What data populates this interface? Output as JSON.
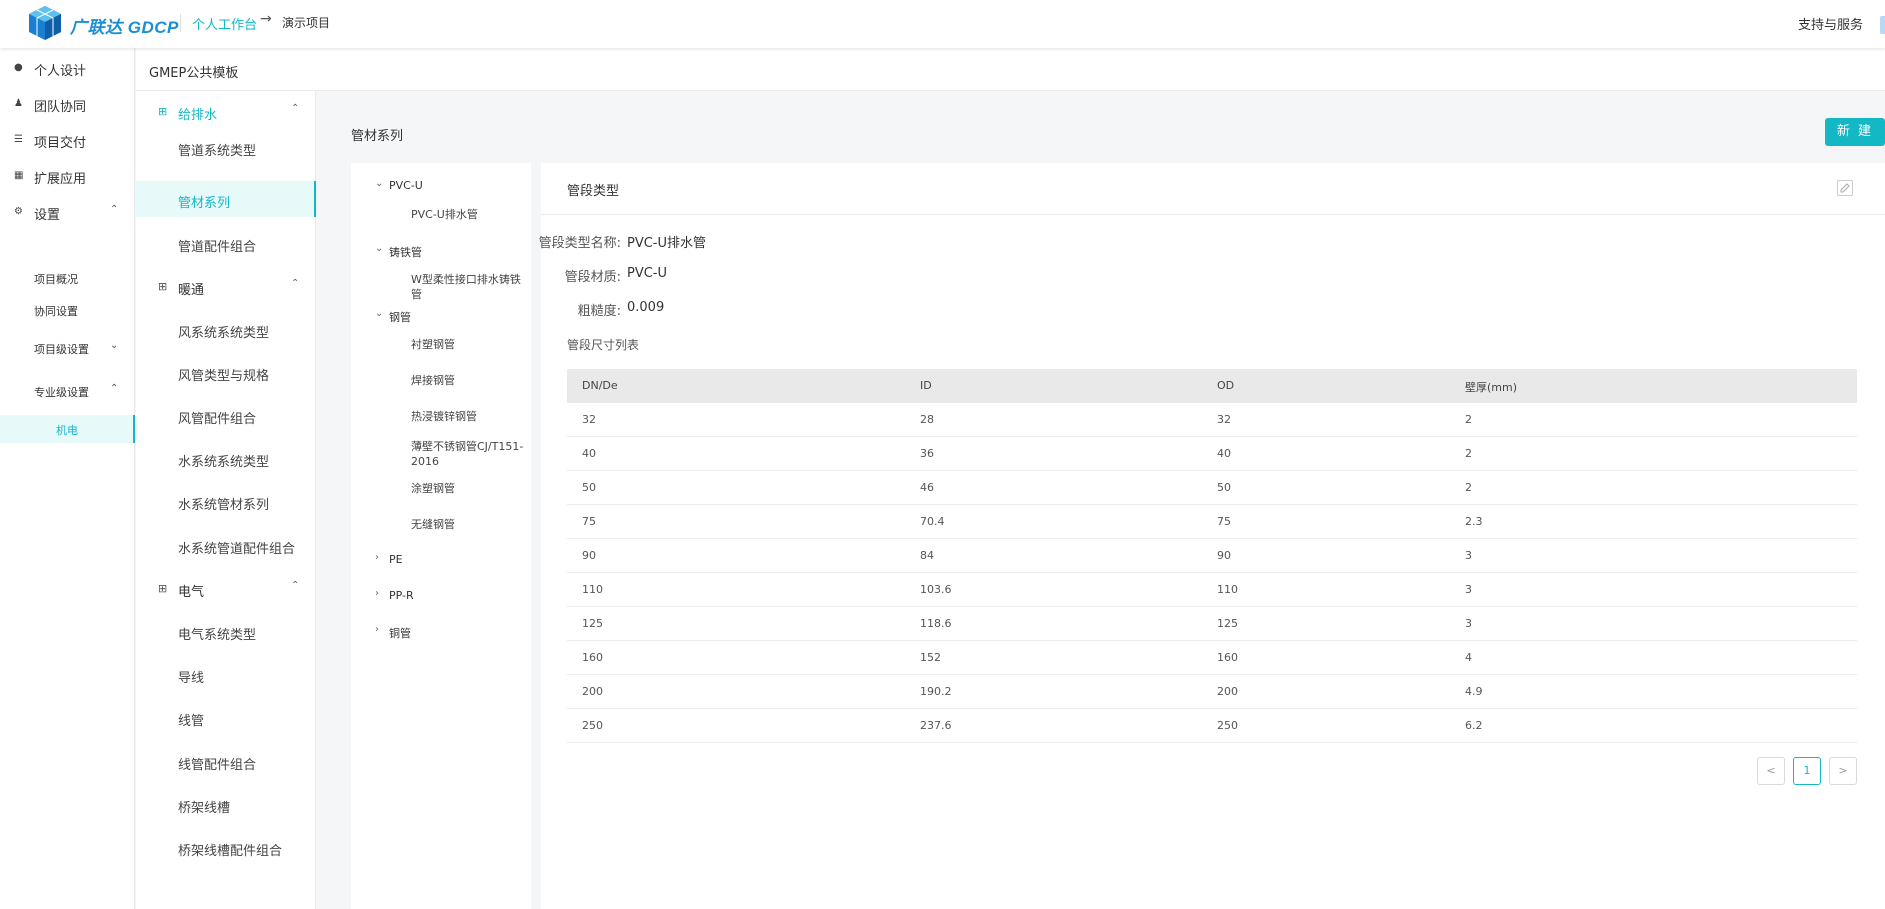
{
  "header": {
    "logo_text": "广联达 GDCP",
    "breadcrumb": [
      "个人工作台",
      "演示项目"
    ],
    "support": "支持与服务"
  },
  "sidebar": {
    "items": [
      {
        "label": "个人设计",
        "icon": "user-icon"
      },
      {
        "label": "团队协同",
        "icon": "team-icon"
      },
      {
        "label": "项目交付",
        "icon": "layers-icon"
      },
      {
        "label": "扩展应用",
        "icon": "apps-icon"
      },
      {
        "label": "设置",
        "icon": "gear-icon"
      }
    ],
    "settings_sub": {
      "overview": "项目概况",
      "collab": "协同设置",
      "project_level": "项目级设置",
      "specialty_level": "专业级设置",
      "mep": "机电"
    }
  },
  "template": {
    "title": "GMEP公共模板",
    "groups": [
      {
        "label": "给排水",
        "items": [
          "管道系统类型",
          "管材系列",
          "管道配件组合"
        ]
      },
      {
        "label": "暖通",
        "items": [
          "风系统系统类型",
          "风管类型与规格",
          "风管配件组合",
          "水系统系统类型",
          "水系统管材系列",
          "水系统管道配件组合"
        ]
      },
      {
        "label": "电气",
        "items": [
          "电气系统类型",
          "导线",
          "线管",
          "线管配件组合",
          "桥架线槽",
          "桥架线槽配件组合"
        ]
      }
    ]
  },
  "main": {
    "section_title": "管材系列",
    "new_button": "新 建",
    "tree": {
      "pvcu": "PVC-U",
      "pvcu_leaf": "PVC-U排水管",
      "cast_iron": "铸铁管",
      "cast_iron_leaf": "W型柔性接口排水铸铁管",
      "steel": "钢管",
      "steel_leaves": [
        "衬塑钢管",
        "焊接钢管",
        "热浸镀锌钢管",
        "薄壁不锈钢管CJ/T151-2016",
        "涂塑钢管",
        "无缝钢管"
      ],
      "pe": "PE",
      "ppr": "PP-R",
      "copper": "铜管"
    },
    "detail": {
      "title": "管段类型",
      "name_label": "管段类型名称:",
      "name_value": "PVC-U排水管",
      "material_label": "管段材质:",
      "material_value": "PVC-U",
      "roughness_label": "粗糙度:",
      "roughness_value": "0.009",
      "list_title": "管段尺寸列表",
      "columns": [
        "DN/De",
        "ID",
        "OD",
        "壁厚(mm)"
      ],
      "rows": [
        [
          "32",
          "28",
          "32",
          "2"
        ],
        [
          "40",
          "36",
          "40",
          "2"
        ],
        [
          "50",
          "46",
          "50",
          "2"
        ],
        [
          "75",
          "70.4",
          "75",
          "2.3"
        ],
        [
          "90",
          "84",
          "90",
          "3"
        ],
        [
          "110",
          "103.6",
          "110",
          "3"
        ],
        [
          "125",
          "118.6",
          "125",
          "3"
        ],
        [
          "160",
          "152",
          "160",
          "4"
        ],
        [
          "200",
          "190.2",
          "200",
          "4.9"
        ],
        [
          "250",
          "237.6",
          "250",
          "6.2"
        ]
      ]
    },
    "pagination": {
      "prev": "<",
      "page": "1",
      "next": ">"
    }
  },
  "colors": {
    "accent": "#14b8c4",
    "active_bg": "#e7f9f8"
  }
}
